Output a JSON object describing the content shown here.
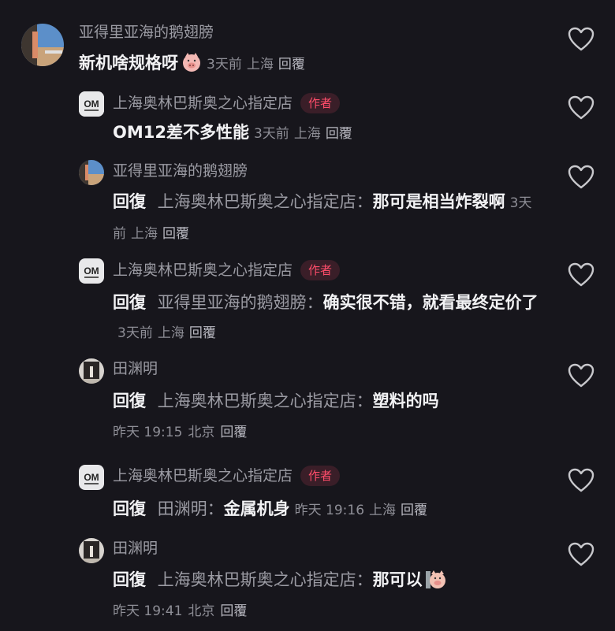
{
  "comments": [
    {
      "username": "亚得里亚海的鹅翅膀",
      "text": "新机啥规格呀",
      "emoji": "pig-face-emoji",
      "time": "3天前",
      "location": "上海",
      "reply_label": "回覆"
    },
    {
      "username": "上海奥林巴斯奥之心指定店",
      "badge": "作者",
      "text": "OM12差不多性能",
      "time": "3天前",
      "location": "上海",
      "reply_label": "回覆"
    },
    {
      "username": "亚得里亚海的鹅翅膀",
      "reply_word": "回復",
      "reply_target": "上海奥林巴斯奥之心指定店：",
      "text": "那可是相当炸裂啊",
      "time": "3天前",
      "location": "上海",
      "reply_label": "回覆"
    },
    {
      "username": "上海奥林巴斯奥之心指定店",
      "badge": "作者",
      "reply_word": "回復",
      "reply_target": "亚得里亚海的鹅翅膀：",
      "text": "确实很不错，就看最终定价了",
      "time": "3天前",
      "location": "上海",
      "reply_label": "回覆"
    },
    {
      "username": "田渊明",
      "reply_word": "回復",
      "reply_target": "上海奥林巴斯奥之心指定店：",
      "text": "塑料的吗",
      "time": "昨天 19:15",
      "location": "北京",
      "reply_label": "回覆"
    },
    {
      "username": "上海奥林巴斯奥之心指定店",
      "badge": "作者",
      "reply_word": "回復",
      "reply_target": "田渊明：",
      "text": "金属机身",
      "time": "昨天 19:16",
      "location": "上海",
      "reply_label": "回覆"
    },
    {
      "username": "田渊明",
      "reply_word": "回復",
      "reply_target": "上海奥林巴斯奥之心指定店：",
      "text": "那可以",
      "emoji": "pig-face-emoji",
      "time": "昨天 19:41",
      "location": "北京",
      "reply_label": "回覆"
    }
  ],
  "icons": {
    "like": "heart-outline-icon",
    "om_logo_text": "OM"
  },
  "colors": {
    "background": "#17161c",
    "username": "#9b9ba3",
    "text": "#f2f2f4",
    "badge": "#ff4d6a"
  }
}
